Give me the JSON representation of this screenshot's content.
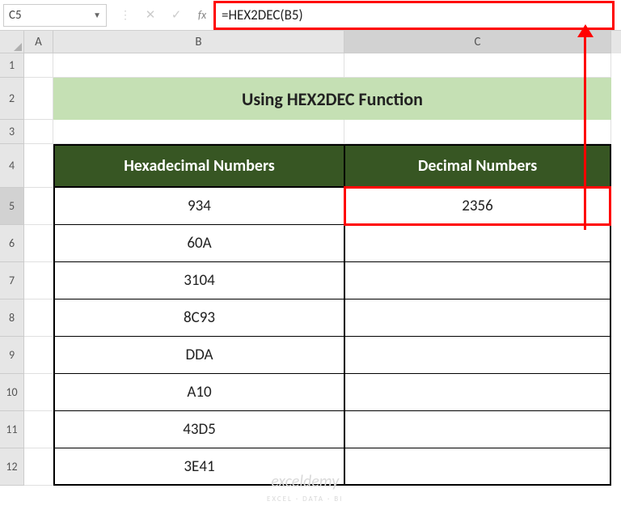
{
  "nameBox": {
    "value": "C5"
  },
  "formulaBar": {
    "value": "=HEX2DEC(B5)"
  },
  "columns": {
    "A": "A",
    "B": "B",
    "C": "C"
  },
  "rows": [
    "1",
    "2",
    "3",
    "4",
    "5",
    "6",
    "7",
    "8",
    "9",
    "10",
    "11",
    "12"
  ],
  "title": "Using HEX2DEC Function",
  "headers": {
    "hex": "Hexadecimal Numbers",
    "dec": "Decimal Numbers"
  },
  "tableRows": [
    {
      "hex": "934",
      "dec": "2356"
    },
    {
      "hex": "60A",
      "dec": ""
    },
    {
      "hex": "3104",
      "dec": ""
    },
    {
      "hex": "8C93",
      "dec": ""
    },
    {
      "hex": "DDA",
      "dec": ""
    },
    {
      "hex": "A10",
      "dec": ""
    },
    {
      "hex": "43D5",
      "dec": ""
    },
    {
      "hex": "3E41",
      "dec": ""
    }
  ],
  "watermark": {
    "main": "exceldemy",
    "sub": "EXCEL · DATA · BI"
  },
  "chart_data": {
    "type": "table",
    "title": "Using HEX2DEC Function",
    "columns": [
      "Hexadecimal Numbers",
      "Decimal Numbers"
    ],
    "rows": [
      [
        "934",
        2356
      ],
      [
        "60A",
        null
      ],
      [
        "3104",
        null
      ],
      [
        "8C93",
        null
      ],
      [
        "DDA",
        null
      ],
      [
        "A10",
        null
      ],
      [
        "43D5",
        null
      ],
      [
        "3E41",
        null
      ]
    ]
  }
}
